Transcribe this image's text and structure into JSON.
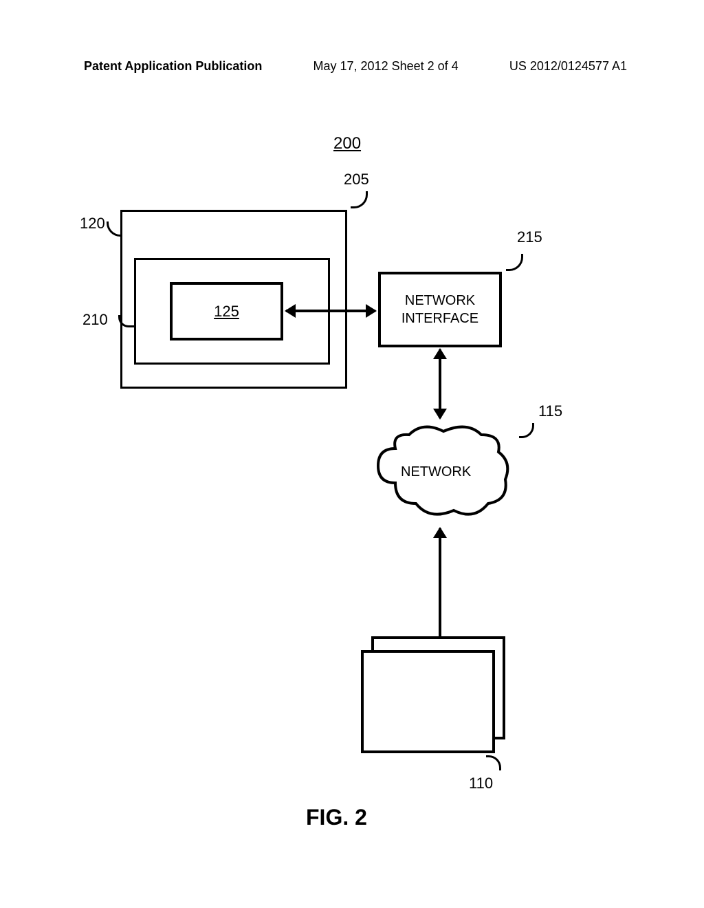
{
  "header": {
    "left": "Patent Application Publication",
    "center": "May 17, 2012  Sheet 2 of 4",
    "right": "US 2012/0124577 A1"
  },
  "figure_number": "200",
  "labels": {
    "ref_205": "205",
    "ref_120": "120",
    "ref_210": "210",
    "ref_125": "125",
    "ref_215": "215",
    "ref_115": "115",
    "ref_110": "110"
  },
  "boxes": {
    "network_interface": "NETWORK\nINTERFACE",
    "network": "NETWORK"
  },
  "figure_caption": "FIG. 2"
}
